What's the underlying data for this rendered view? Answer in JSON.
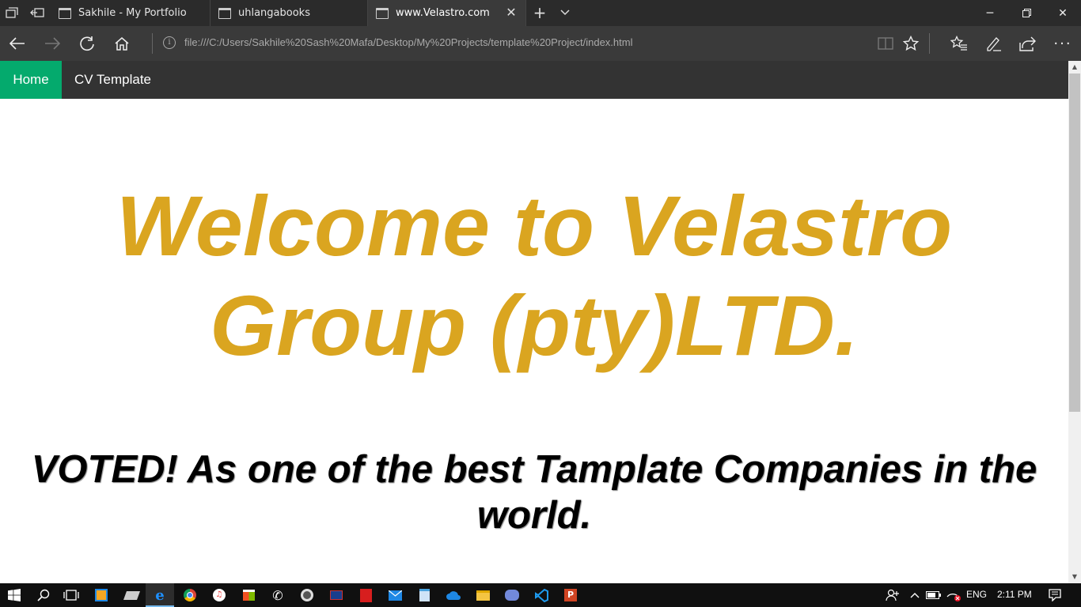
{
  "tabs": [
    {
      "title": "Sakhile - My Portfolio"
    },
    {
      "title": "uhlangabooks"
    },
    {
      "title": "www.Velastro.com"
    }
  ],
  "address": {
    "url": "file:///C:/Users/Sakhile%20Sash%20Mafa/Desktop/My%20Projects/template%20Project/index.html"
  },
  "site_nav": {
    "items": [
      {
        "label": "Home"
      },
      {
        "label": "CV Template"
      }
    ]
  },
  "hero": {
    "line1": "Welcome to Velastro",
    "line2": "Group (pty)LTD."
  },
  "subtitle": {
    "line1": "VOTED! As one of the best Tamplate Companies in the",
    "line2": "world."
  },
  "taskbar": {
    "language": "ENG",
    "time": "2:11 PM"
  },
  "colors": {
    "hero": "#daa520",
    "nav_active": "#04aa6d",
    "nav_bg": "#333333"
  }
}
